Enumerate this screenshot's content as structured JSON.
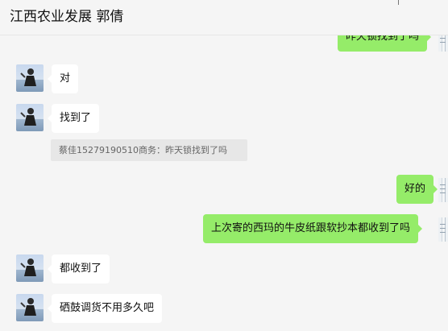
{
  "header": {
    "title": "江西农业发展 郭倩"
  },
  "messages": [
    {
      "side": "out",
      "text": "昨天锁找到了吗"
    },
    {
      "side": "in",
      "text": "对"
    },
    {
      "side": "in",
      "text": "找到了"
    },
    {
      "side": "quote",
      "text": "蔡佳15279190510商务：昨天锁找到了吗"
    },
    {
      "side": "out",
      "text": "好的"
    },
    {
      "side": "out",
      "text": "上次寄的西玛的牛皮纸跟软抄本都收到了吗"
    },
    {
      "side": "in",
      "text": "都收到了"
    },
    {
      "side": "in",
      "text": "硒鼓调货不用多久吧"
    }
  ]
}
